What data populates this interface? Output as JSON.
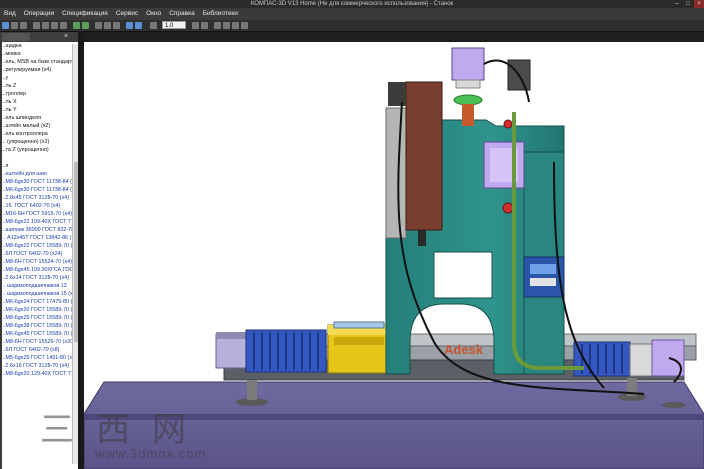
{
  "window": {
    "title": "КОМПАС-3D V13 Home (Не для коммерческого использования) - Станок"
  },
  "menu": [
    "Вид",
    "Операции",
    "Спецификация",
    "Сервис",
    "Окно",
    "Справка",
    "Библиотеки"
  ],
  "toolbar": {
    "zoom_value": "1.0"
  },
  "tree": {
    "rows": [
      "...щадка",
      "...мника",
      "...ель, MSB на базе стандартнос",
      "...регулируемая (x4)",
      "...y",
      "...ль Z",
      "...троллер",
      "...ль X",
      "...ль Y",
      "...ель шпинделя",
      "...штейн малый (x2)",
      "...ель контроллера",
      "... (упрощенно) (x2)",
      "...та Z (упрощенно)",
      "",
      "...я",
      "...нштейн для шин",
      "...М8-6gx30 ГОСТ 11738-84 (x22)",
      "...М6-6gx30 ГОСТ 11738-84 (x6)",
      "...2.8x45 ГОСТ 3128-70 (x4)",
      "...16. ГОСТ 6402-70 (x4)",
      "...М16-6Н ГОСТ 5915-70 (x4)",
      "...М8-6gx22.109.40Х ГОСТ 7796-70",
      "...шипник 36000 ГОСТ 832-78 (x4)",
      "... А12x45Т ГОСТ 13842-86 (x4)",
      "...М8-6gx22 ГОСТ 15589-70 (x4)",
      "...6Л ГОСТ 6402-70 (x24)",
      "...М8-6Н ГОСТ 15524-70 (x4)",
      "...М8-6gx45.109.30ХГСА ГОСТ 117",
      "...2.6x14 ГОСТ 3128-70 (x4)",
      "... шарикоподшипников 12",
      "... шарикоподшипников 15 (x2)",
      "...М6-6gx24 ГОСТ 17475-80 (x3)",
      "...М6-6gx20 ГОСТ 15589-70 (x4)",
      "...М8-6gx25 ГОСТ 15589-70 (x12)",
      "...М8-6gx38 ГОСТ 15589-70 (x4)",
      "...М6-6gx45 ГОСТ 15589-70 (x4)",
      "...М8-6Н ГОСТ 15526-70 (x20)",
      "...6Л ГОСТ 6402-70 (x8)",
      "...М5-6gx25 ГОСТ 1491-80 (x20)",
      "...2.6x16 ГОСТ 3128-70 (x4)",
      "...М8-6gx20.129.40Х ГОСТ 7798-70"
    ]
  },
  "model": {
    "brand_text": "Adesk"
  },
  "watermark": {
    "chars": "三西网",
    "url": "www.3dmox.com"
  },
  "colors": {
    "frame": "#2b8a84",
    "purple": "#b9a3e8",
    "blue_guard": "#3b5cc4",
    "yellow": "#e6c619",
    "floor": "#6a6496"
  }
}
